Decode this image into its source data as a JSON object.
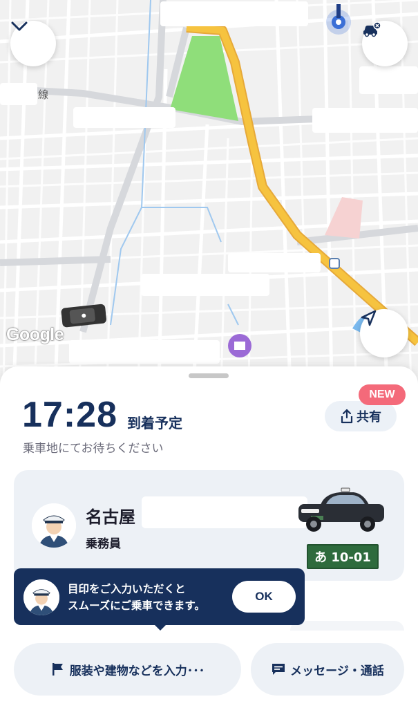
{
  "map": {
    "line_label": "線",
    "provider_logo": "Google",
    "collapse_icon": "chevron-down-icon",
    "car_settings_icon": "car-remove-icon",
    "locate_icon": "navigation-arrow-icon",
    "route_color": "#f6c33f",
    "park_color": "#8fde7a"
  },
  "sheet": {
    "eta_time": "17:28",
    "eta_label": "到着予定",
    "wait_message": "乗車地にてお待ちください",
    "new_badge": "NEW",
    "share_label": "共有",
    "driver": {
      "name": "名古屋",
      "role": "乗務員",
      "plate": "あ 10-01"
    },
    "tip": {
      "line1": "目印をご入力いただくと",
      "line2": "スムーズにご乗車できます。",
      "ok_label": "OK"
    },
    "actions": {
      "landmark_label": "服装や建物などを入力･･･",
      "message_label": "メッセージ・通話"
    }
  },
  "colors": {
    "navy": "#17305c",
    "new_badge": "#f46a7a",
    "plate_green": "#2e6b3d"
  }
}
